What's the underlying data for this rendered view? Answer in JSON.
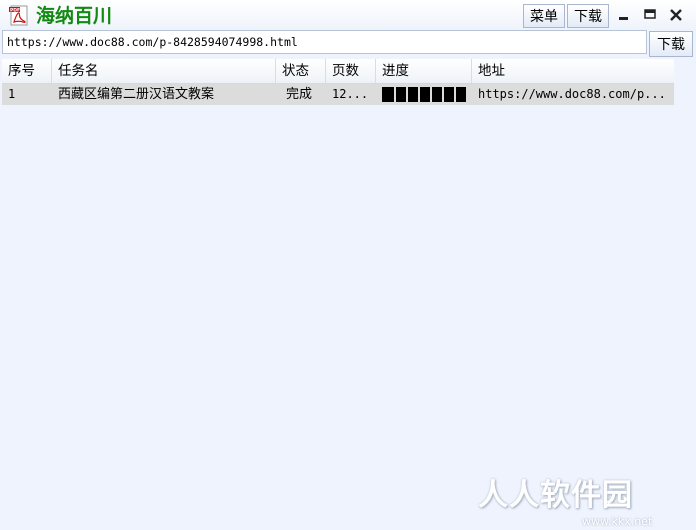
{
  "app": {
    "title": "海纳百川",
    "menu_label": "菜单",
    "download_label": "下载"
  },
  "url_input": {
    "value": "https://www.doc88.com/p-8428594074998.html",
    "download_label": "下载"
  },
  "table": {
    "columns": [
      "序号",
      "任务名",
      "状态",
      "页数",
      "进度",
      "地址"
    ],
    "rows": [
      {
        "index": "1",
        "name": "西藏区编第二册汉语文教案",
        "status": "完成",
        "pages": "12...",
        "progress": 1.0,
        "address": "https://www.doc88.com/p..."
      }
    ]
  },
  "watermark": {
    "main": "人人软件园",
    "sub": "www.kkx.net"
  },
  "colors": {
    "title_green": "#128a12",
    "window_bg": "#eef3fd",
    "row_bg": "#dcdcdc"
  },
  "icons": [
    "pdf-app-icon",
    "minimize-icon",
    "maximize-icon",
    "close-icon"
  ]
}
